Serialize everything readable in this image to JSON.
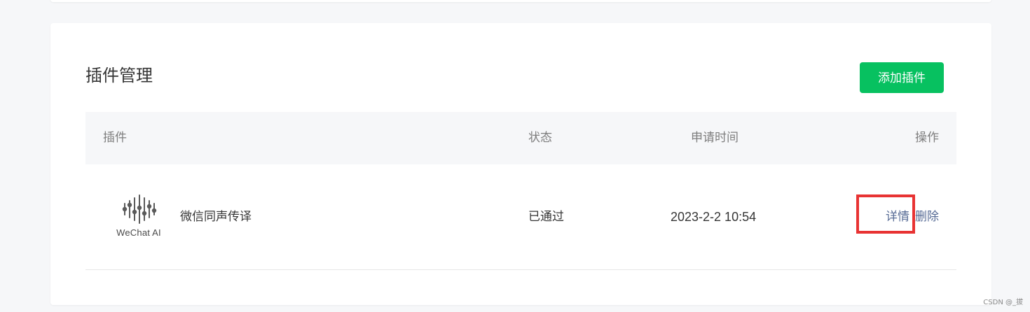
{
  "card": {
    "title": "插件管理",
    "add_button_label": "添加插件"
  },
  "table": {
    "headers": {
      "plugin": "插件",
      "status": "状态",
      "time": "申请时间",
      "action": "操作"
    },
    "rows": [
      {
        "logo_text": "WeChat AI",
        "logo_icon": "wechat-ai-logo",
        "name": "微信同声传译",
        "status": "已通过",
        "time": "2023-2-2 10:54",
        "actions": {
          "detail": "详情",
          "delete": "删除"
        }
      }
    ]
  },
  "annotation": {
    "highlight_color": "#e83333"
  },
  "colors": {
    "accent_green": "#07c160",
    "link_blue": "#576b95"
  },
  "watermark": "CSDN @_拔"
}
